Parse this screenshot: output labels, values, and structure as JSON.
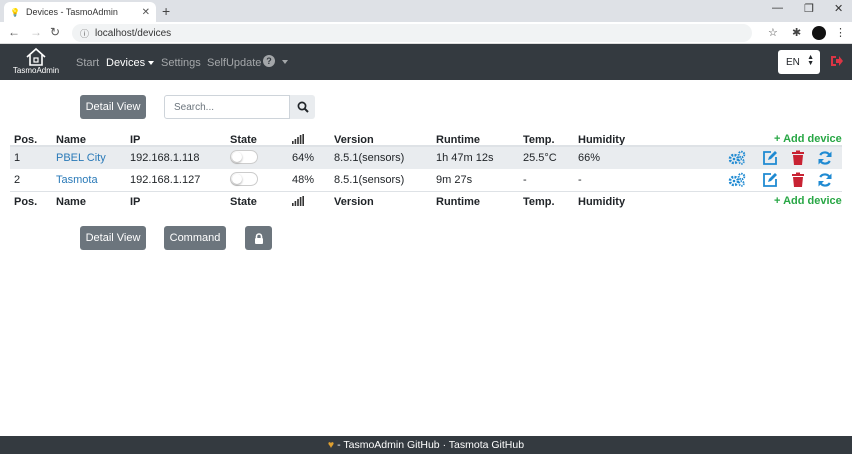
{
  "browser": {
    "tab_title": "Devices - TasmoAdmin",
    "url": "localhost/devices"
  },
  "navbar": {
    "brand": "TasmoAdmin",
    "links": [
      "Start",
      "Devices",
      "Settings",
      "SelfUpdate"
    ],
    "language": "EN"
  },
  "toolbar": {
    "detail_view": "Detail View",
    "search_placeholder": "Search...",
    "command": "Command"
  },
  "table": {
    "columns": [
      "Pos.",
      "Name",
      "IP",
      "State",
      "Version",
      "Runtime",
      "Temp.",
      "Humidity"
    ],
    "add_device": "+ Add device",
    "rows": [
      {
        "pos": "1",
        "name": "PBEL City",
        "ip": "192.168.1.118",
        "signal": "64%",
        "version": "8.5.1(sensors)",
        "runtime": "1h 47m 12s",
        "temp": "25.5°C",
        "humidity": "66%"
      },
      {
        "pos": "2",
        "name": "Tasmota",
        "ip": "192.168.1.127",
        "signal": "48%",
        "version": "8.5.1(sensors)",
        "runtime": "9m 27s",
        "temp": "-",
        "humidity": "-"
      }
    ]
  },
  "footer": {
    "text": "- TasmoAdmin GitHub · Tasmota GitHub"
  },
  "colors": {
    "navbar_bg": "#343a40",
    "link_blue": "#2a7ab8",
    "add_green": "#28a745",
    "delete_red": "#c82333",
    "action_blue": "#1f8ad2"
  }
}
